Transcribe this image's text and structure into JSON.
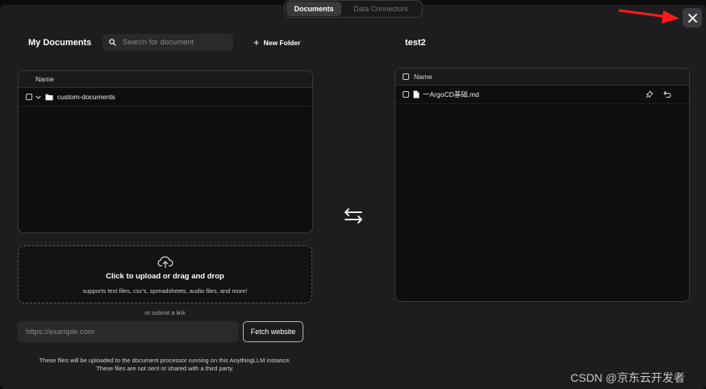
{
  "tabs": [
    {
      "label": "Documents",
      "active": true
    },
    {
      "label": "Data Connectors",
      "active": false
    }
  ],
  "left": {
    "title": "My Documents",
    "search_placeholder": "Search for document",
    "new_folder_label": "New Folder",
    "table_header": "Name",
    "rows": [
      {
        "name": "custom-documents",
        "type": "folder",
        "expanded": false
      }
    ],
    "upload": {
      "title": "Click to upload or drag and drop",
      "subtitle": "supports text files, csv's, spreadsheets, audio files, and more!"
    },
    "or_link": "or submit a link",
    "url_placeholder": "https://example.com",
    "fetch_label": "Fetch website",
    "footer_line1": "These files will be uploaded to the document processor running on this AnythingLLM instance.",
    "footer_line2": "These files are not sent or shared with a third party."
  },
  "right": {
    "title": "test2",
    "table_header": "Name",
    "rows": [
      {
        "name": "一ArgoCD基础.md",
        "type": "file"
      }
    ]
  },
  "icons": {
    "close": "close-icon",
    "swap": "swap-arrows-icon",
    "search": "search-icon",
    "upload": "cloud-upload-icon",
    "pin": "pin-icon",
    "undo": "undo-icon",
    "folder": "folder-icon",
    "file": "file-icon"
  },
  "watermark": "CSDN @京东云开发者",
  "colors": {
    "annotation_arrow": "#ff1a1a",
    "background": "#1d1d1f",
    "panel": "#0e0e10"
  }
}
